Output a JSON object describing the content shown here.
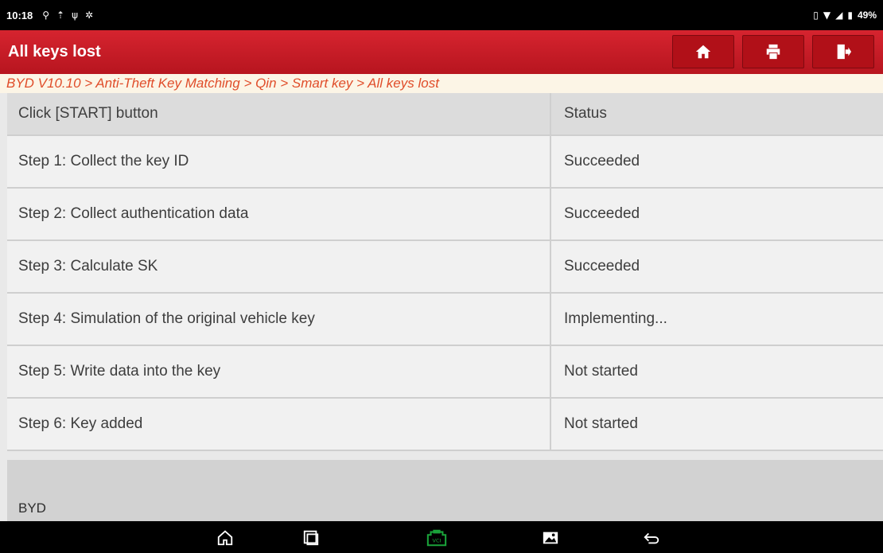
{
  "status_bar": {
    "time": "10:18",
    "left_icons": [
      "location-icon",
      "upload-icon",
      "usb-icon",
      "bluetooth-icon"
    ],
    "right_icons": [
      "vibrate-icon",
      "wifi-icon",
      "signal-icon",
      "battery-icon"
    ],
    "battery": "49%"
  },
  "header": {
    "title": "All keys lost",
    "buttons": [
      "home-icon",
      "print-icon",
      "exit-icon"
    ],
    "accent_color": "#c8161f"
  },
  "breadcrumb": "BYD V10.10 > Anti-Theft Key Matching > Qin > Smart key > All keys lost",
  "table": {
    "columns": [
      "Click [START] button",
      "Status"
    ],
    "rows": [
      {
        "step": "Step 1: Collect the key ID",
        "status": "Succeeded"
      },
      {
        "step": "Step 2: Collect authentication data",
        "status": "Succeeded"
      },
      {
        "step": "Step 3: Calculate SK",
        "status": "Succeeded"
      },
      {
        "step": "Step 4: Simulation of the original vehicle key",
        "status": "Implementing..."
      },
      {
        "step": "Step 5: Write data into the key",
        "status": "Not started"
      },
      {
        "step": "Step 6: Key added",
        "status": "Not started"
      }
    ]
  },
  "footer": {
    "vendor": "BYD"
  },
  "nav_bar": {
    "icons": [
      "home-icon",
      "recents-icon",
      "vci-icon",
      "gallery-icon",
      "back-icon"
    ],
    "vci_color": "#1aa33a"
  }
}
